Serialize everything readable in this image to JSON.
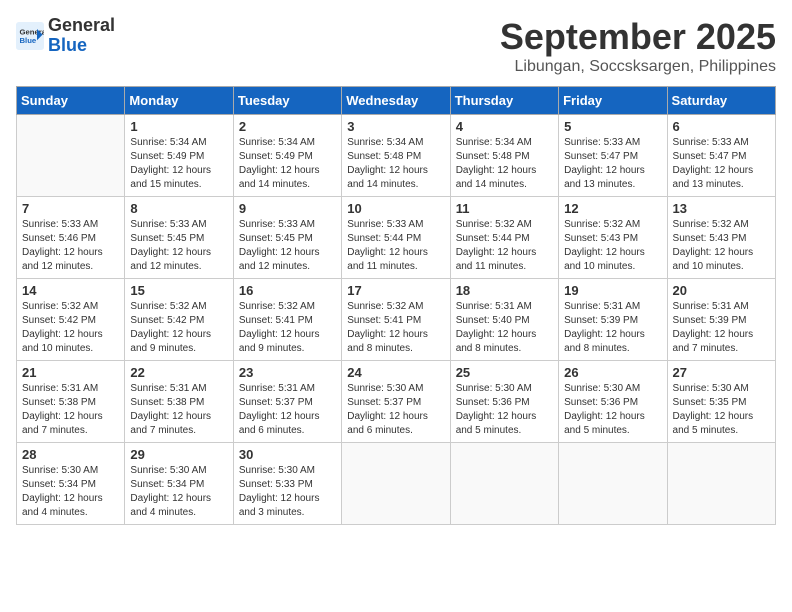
{
  "logo": {
    "line1": "General",
    "line2": "Blue"
  },
  "title": "September 2025",
  "location": "Libungan, Soccsksargen, Philippines",
  "days_of_week": [
    "Sunday",
    "Monday",
    "Tuesday",
    "Wednesday",
    "Thursday",
    "Friday",
    "Saturday"
  ],
  "weeks": [
    [
      {
        "day": "",
        "info": ""
      },
      {
        "day": "1",
        "info": "Sunrise: 5:34 AM\nSunset: 5:49 PM\nDaylight: 12 hours\nand 15 minutes."
      },
      {
        "day": "2",
        "info": "Sunrise: 5:34 AM\nSunset: 5:49 PM\nDaylight: 12 hours\nand 14 minutes."
      },
      {
        "day": "3",
        "info": "Sunrise: 5:34 AM\nSunset: 5:48 PM\nDaylight: 12 hours\nand 14 minutes."
      },
      {
        "day": "4",
        "info": "Sunrise: 5:34 AM\nSunset: 5:48 PM\nDaylight: 12 hours\nand 14 minutes."
      },
      {
        "day": "5",
        "info": "Sunrise: 5:33 AM\nSunset: 5:47 PM\nDaylight: 12 hours\nand 13 minutes."
      },
      {
        "day": "6",
        "info": "Sunrise: 5:33 AM\nSunset: 5:47 PM\nDaylight: 12 hours\nand 13 minutes."
      }
    ],
    [
      {
        "day": "7",
        "info": "Sunrise: 5:33 AM\nSunset: 5:46 PM\nDaylight: 12 hours\nand 12 minutes."
      },
      {
        "day": "8",
        "info": "Sunrise: 5:33 AM\nSunset: 5:45 PM\nDaylight: 12 hours\nand 12 minutes."
      },
      {
        "day": "9",
        "info": "Sunrise: 5:33 AM\nSunset: 5:45 PM\nDaylight: 12 hours\nand 12 minutes."
      },
      {
        "day": "10",
        "info": "Sunrise: 5:33 AM\nSunset: 5:44 PM\nDaylight: 12 hours\nand 11 minutes."
      },
      {
        "day": "11",
        "info": "Sunrise: 5:32 AM\nSunset: 5:44 PM\nDaylight: 12 hours\nand 11 minutes."
      },
      {
        "day": "12",
        "info": "Sunrise: 5:32 AM\nSunset: 5:43 PM\nDaylight: 12 hours\nand 10 minutes."
      },
      {
        "day": "13",
        "info": "Sunrise: 5:32 AM\nSunset: 5:43 PM\nDaylight: 12 hours\nand 10 minutes."
      }
    ],
    [
      {
        "day": "14",
        "info": "Sunrise: 5:32 AM\nSunset: 5:42 PM\nDaylight: 12 hours\nand 10 minutes."
      },
      {
        "day": "15",
        "info": "Sunrise: 5:32 AM\nSunset: 5:42 PM\nDaylight: 12 hours\nand 9 minutes."
      },
      {
        "day": "16",
        "info": "Sunrise: 5:32 AM\nSunset: 5:41 PM\nDaylight: 12 hours\nand 9 minutes."
      },
      {
        "day": "17",
        "info": "Sunrise: 5:32 AM\nSunset: 5:41 PM\nDaylight: 12 hours\nand 8 minutes."
      },
      {
        "day": "18",
        "info": "Sunrise: 5:31 AM\nSunset: 5:40 PM\nDaylight: 12 hours\nand 8 minutes."
      },
      {
        "day": "19",
        "info": "Sunrise: 5:31 AM\nSunset: 5:39 PM\nDaylight: 12 hours\nand 8 minutes."
      },
      {
        "day": "20",
        "info": "Sunrise: 5:31 AM\nSunset: 5:39 PM\nDaylight: 12 hours\nand 7 minutes."
      }
    ],
    [
      {
        "day": "21",
        "info": "Sunrise: 5:31 AM\nSunset: 5:38 PM\nDaylight: 12 hours\nand 7 minutes."
      },
      {
        "day": "22",
        "info": "Sunrise: 5:31 AM\nSunset: 5:38 PM\nDaylight: 12 hours\nand 7 minutes."
      },
      {
        "day": "23",
        "info": "Sunrise: 5:31 AM\nSunset: 5:37 PM\nDaylight: 12 hours\nand 6 minutes."
      },
      {
        "day": "24",
        "info": "Sunrise: 5:30 AM\nSunset: 5:37 PM\nDaylight: 12 hours\nand 6 minutes."
      },
      {
        "day": "25",
        "info": "Sunrise: 5:30 AM\nSunset: 5:36 PM\nDaylight: 12 hours\nand 5 minutes."
      },
      {
        "day": "26",
        "info": "Sunrise: 5:30 AM\nSunset: 5:36 PM\nDaylight: 12 hours\nand 5 minutes."
      },
      {
        "day": "27",
        "info": "Sunrise: 5:30 AM\nSunset: 5:35 PM\nDaylight: 12 hours\nand 5 minutes."
      }
    ],
    [
      {
        "day": "28",
        "info": "Sunrise: 5:30 AM\nSunset: 5:34 PM\nDaylight: 12 hours\nand 4 minutes."
      },
      {
        "day": "29",
        "info": "Sunrise: 5:30 AM\nSunset: 5:34 PM\nDaylight: 12 hours\nand 4 minutes."
      },
      {
        "day": "30",
        "info": "Sunrise: 5:30 AM\nSunset: 5:33 PM\nDaylight: 12 hours\nand 3 minutes."
      },
      {
        "day": "",
        "info": ""
      },
      {
        "day": "",
        "info": ""
      },
      {
        "day": "",
        "info": ""
      },
      {
        "day": "",
        "info": ""
      }
    ]
  ]
}
